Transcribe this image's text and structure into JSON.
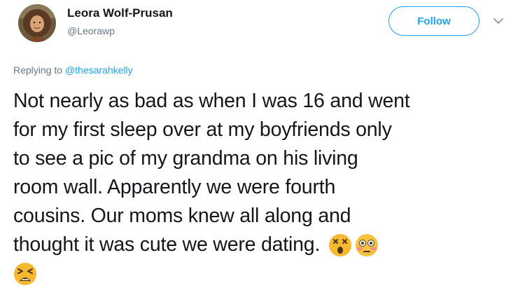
{
  "author": {
    "display_name": "Leora Wolf-Prusan",
    "handle": "@Leorawp"
  },
  "actions": {
    "follow_label": "Follow"
  },
  "reply_context": {
    "prefix": "Replying to ",
    "mention": "@thesarahkelly"
  },
  "tweet": {
    "lines": [
      "Not nearly as bad as when I was 16 and went",
      "for my first sleep over at my boyfriends only",
      "to see a pic of my grandma on his living",
      "room wall. Apparently we were fourth",
      "cousins. Our moms knew all along and",
      "thought it was cute we were dating."
    ],
    "emojis": [
      "dizzy-face-emoji",
      "flushed-face-emoji",
      "tired-face-emoji"
    ]
  },
  "colors": {
    "accent": "#1da1f2",
    "text": "#14171a",
    "secondary_text": "#657786"
  }
}
